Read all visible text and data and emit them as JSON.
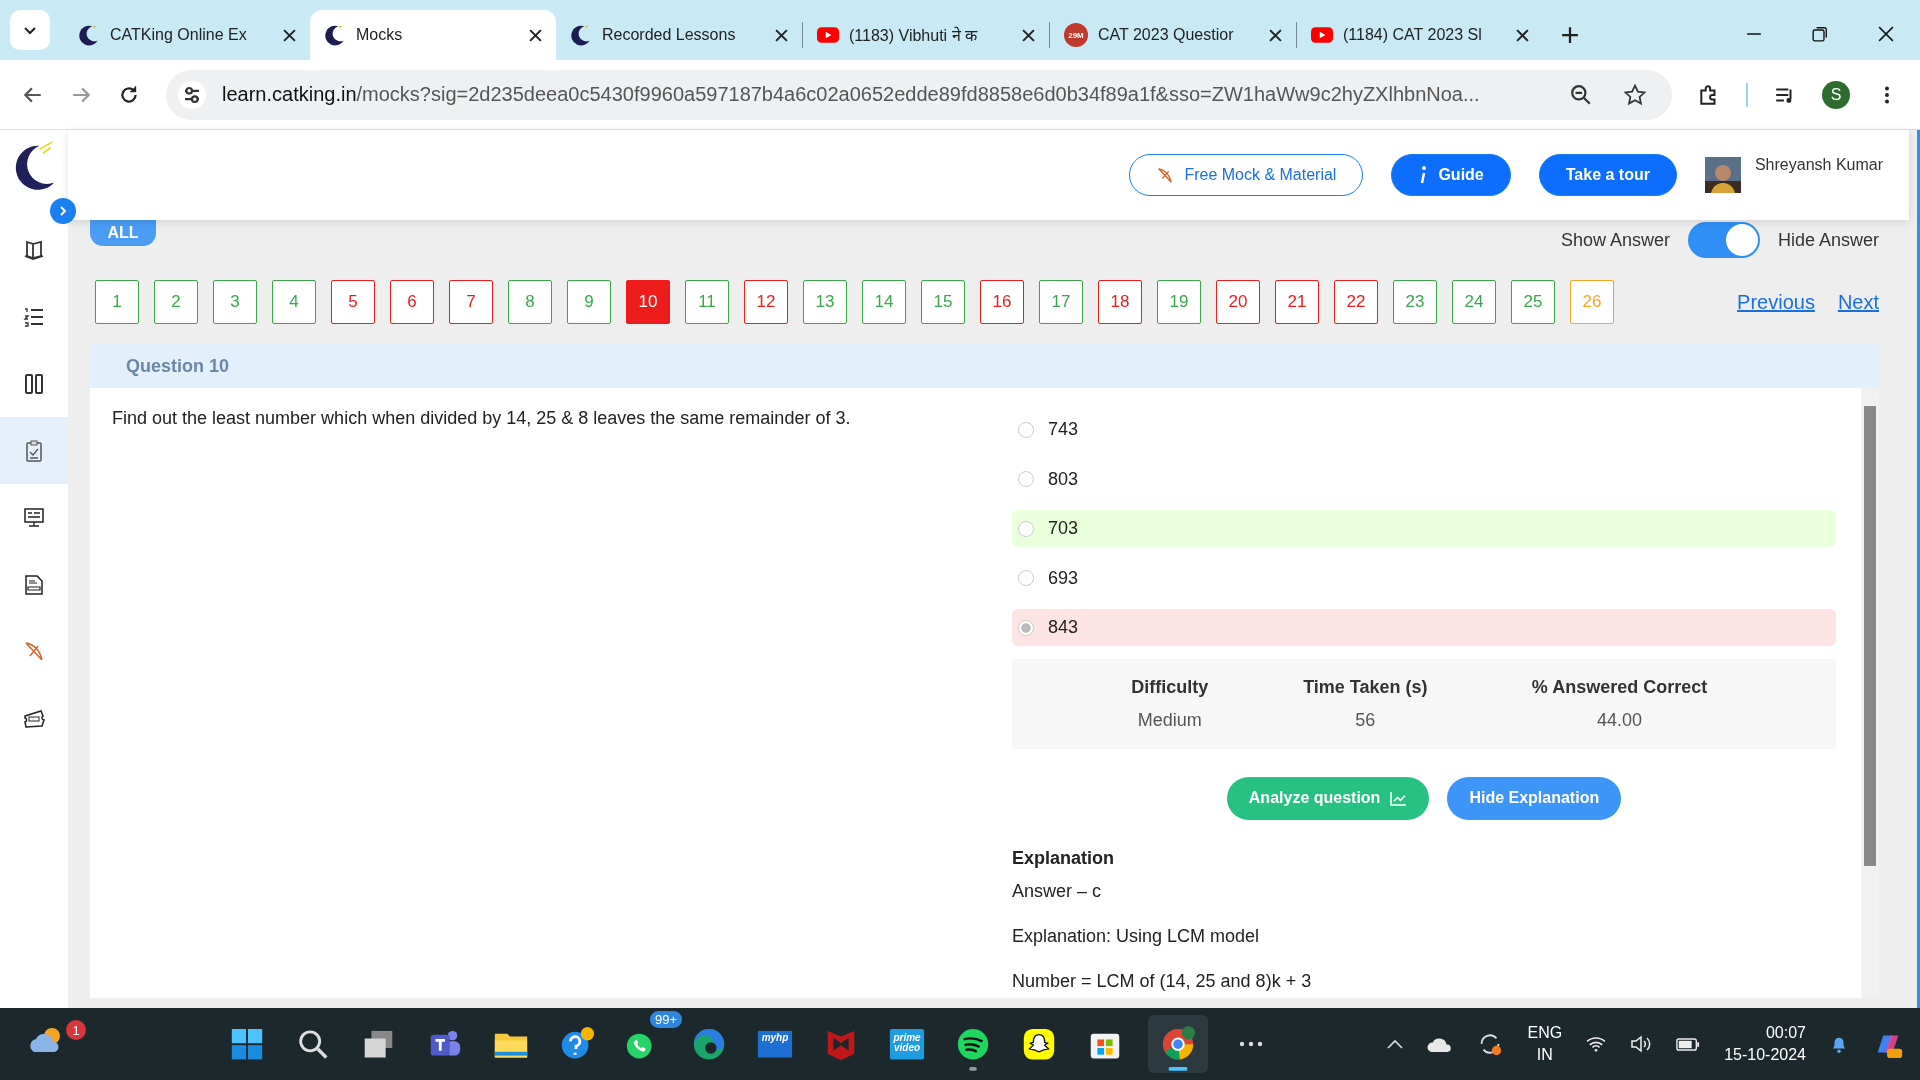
{
  "browser": {
    "tabs": [
      {
        "title": "CATKing Online Ex",
        "kind": "site",
        "selected": false
      },
      {
        "title": "Mocks",
        "kind": "site",
        "selected": true
      },
      {
        "title": "Recorded Lessons",
        "kind": "site",
        "selected": false
      },
      {
        "title": "(1183) Vibhuti ने क",
        "kind": "video",
        "selected": false
      },
      {
        "title": "CAT 2023 Questior",
        "kind": "channel",
        "favicon_text": "29M",
        "selected": false
      },
      {
        "title": "(1184) CAT 2023 Sl",
        "kind": "video",
        "selected": false
      }
    ],
    "url_domain": "learn.catking.in",
    "url_path": "/mocks?sig=2d235deea0c5430f9960a597187b4a6c02a0652edde89fd8858e6d0b34f89a1f&sso=ZW1haWw9c2hyZXlhbnNoa...",
    "profile_initial": "S"
  },
  "sidebar": {
    "items": [
      {
        "selected": false
      },
      {
        "selected": false
      },
      {
        "selected": false
      },
      {
        "selected": true
      },
      {
        "selected": false
      },
      {
        "selected": false
      },
      {
        "selected": false
      },
      {
        "selected": false
      }
    ]
  },
  "header": {
    "buttons": [
      {
        "label": "Free Mock & Material",
        "kind": "outline"
      },
      {
        "label": "Guide",
        "kind": "info"
      },
      {
        "label": "Take a tour",
        "kind": "solid"
      }
    ],
    "user_name": "Shreyansh Kumar"
  },
  "filter": {
    "label": "ALL"
  },
  "answer_toggle": {
    "show_label": "Show Answer",
    "hide_label": "Hide Answer",
    "on": true
  },
  "questions": [
    {
      "n": "1",
      "color": "#3aa84a",
      "selected": false
    },
    {
      "n": "2",
      "color": "#3aa84a",
      "selected": false
    },
    {
      "n": "3",
      "color": "#3aa84a",
      "selected": false
    },
    {
      "n": "4",
      "color": "#3aa84a",
      "selected": false
    },
    {
      "n": "5",
      "color": "#ee1c1c",
      "selected": false
    },
    {
      "n": "6",
      "color": "#ee1c1c",
      "selected": false
    },
    {
      "n": "7",
      "color": "#ee1c1c",
      "selected": false
    },
    {
      "n": "8",
      "color": "#3aa84a",
      "selected": false
    },
    {
      "n": "9",
      "color": "#3aa84a",
      "selected": false
    },
    {
      "n": "10",
      "color": "#ee1c1c",
      "selected": true
    },
    {
      "n": "11",
      "color": "#3aa84a",
      "selected": false
    },
    {
      "n": "12",
      "color": "#ee1c1c",
      "selected": false
    },
    {
      "n": "13",
      "color": "#3aa84a",
      "selected": false
    },
    {
      "n": "14",
      "color": "#3aa84a",
      "selected": false
    },
    {
      "n": "15",
      "color": "#3aa84a",
      "selected": false
    },
    {
      "n": "16",
      "color": "#ee1c1c",
      "selected": false
    },
    {
      "n": "17",
      "color": "#3aa84a",
      "selected": false
    },
    {
      "n": "18",
      "color": "#ee1c1c",
      "selected": false
    },
    {
      "n": "19",
      "color": "#3aa84a",
      "selected": false
    },
    {
      "n": "20",
      "color": "#ee1c1c",
      "selected": false
    },
    {
      "n": "21",
      "color": "#ee1c1c",
      "selected": false
    },
    {
      "n": "22",
      "color": "#ee1c1c",
      "selected": false
    },
    {
      "n": "23",
      "color": "#3aa84a",
      "selected": false
    },
    {
      "n": "24",
      "color": "#3aa84a",
      "selected": false
    },
    {
      "n": "25",
      "color": "#3aa84a",
      "selected": false
    },
    {
      "n": "26",
      "color": "#f5a623",
      "selected": false
    }
  ],
  "nav": {
    "previous": "Previous",
    "next": "Next"
  },
  "question": {
    "heading": "Question 10",
    "text": "Find out the least number which when divided by 14, 25 & 8 leaves the same remainder of 3.",
    "options": [
      {
        "label": "743",
        "correct": false,
        "selected": false
      },
      {
        "label": "803",
        "correct": false,
        "selected": false
      },
      {
        "label": "703",
        "correct": true,
        "selected": false
      },
      {
        "label": "693",
        "correct": false,
        "selected": false
      },
      {
        "label": "843",
        "correct": false,
        "selected": true
      }
    ],
    "stats": [
      {
        "label": "Difficulty",
        "value": "Medium"
      },
      {
        "label": "Time Taken (s)",
        "value": "56"
      },
      {
        "label": "% Answered Correct",
        "value": "44.00"
      }
    ],
    "analyze_button": "Analyze question",
    "explanation_button": "Hide Explanation",
    "explanation_title": "Explanation",
    "explanation_lines": [
      "Answer – c",
      "Explanation: Using LCM model",
      "Number = LCM of (14, 25 and 8)k + 3"
    ]
  },
  "taskbar": {
    "apps": [
      {
        "running": false
      },
      {
        "running": false
      },
      {
        "running": false
      },
      {
        "running": false
      },
      {
        "running": false
      },
      {
        "running": false
      },
      {
        "badge": "99+",
        "running": false
      },
      {
        "running": false
      },
      {
        "text": "myhp",
        "running": false
      },
      {
        "running": false
      },
      {
        "text": "prime video",
        "running": false
      },
      {
        "running": true
      },
      {
        "running": false
      },
      {
        "running": false
      },
      {
        "running": true,
        "selected": true
      }
    ],
    "weather_badge": "1",
    "language": "ENG",
    "region": "IN",
    "time": "00:07",
    "date": "15-10-2024"
  }
}
